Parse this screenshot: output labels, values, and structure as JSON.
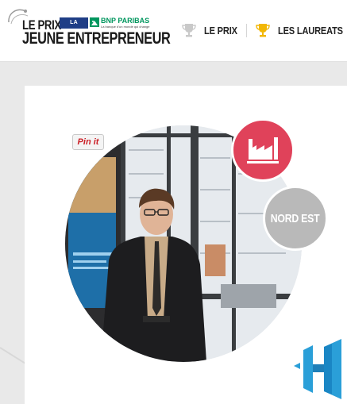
{
  "header": {
    "logo": {
      "line1": "LE PRIX",
      "line2": "JEUNE ENTREPRENEUR",
      "partner_tribune": "LA TRIBUNE",
      "partner_bnp": "BNP PARIBAS",
      "partner_bnp_tagline": "La banque d'un monde qui change"
    },
    "nav": [
      {
        "label": "LE PRIX",
        "icon": "trophy-outline-icon"
      },
      {
        "label": "LES LAUREATS",
        "icon": "trophy-gold-icon"
      }
    ]
  },
  "profile": {
    "pin_button_label": "Pin it",
    "category_icon": "factory-icon",
    "category_color": "#e0425a",
    "region_label": "NORD EST",
    "region_color": "#b9b9b9"
  },
  "colors": {
    "page_bg": "#e9e9e9",
    "card_bg": "#ffffff",
    "brand_blue": "#2a9fd8",
    "bnp_green": "#00965e"
  }
}
